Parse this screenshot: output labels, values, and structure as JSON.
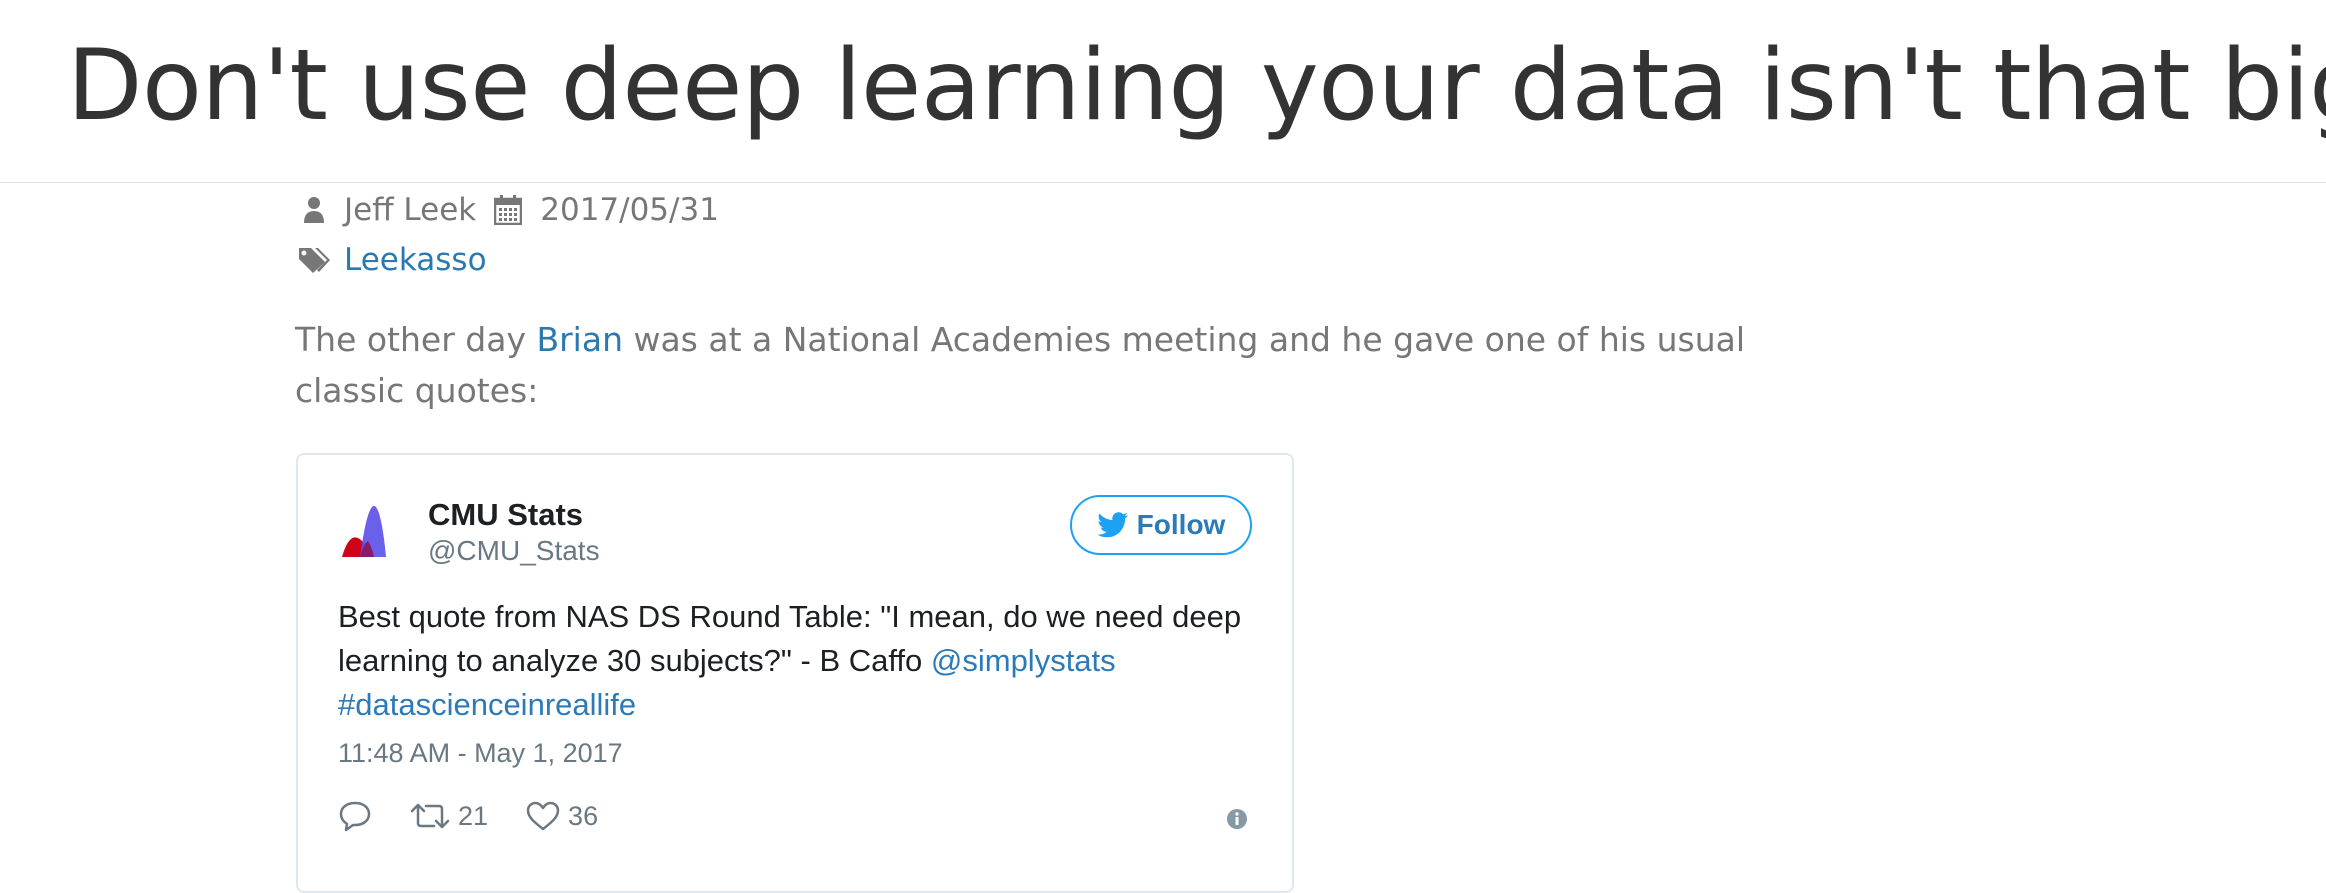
{
  "post": {
    "title": "Don't use deep learning your data isn't that big",
    "author": "Jeff Leek",
    "date": "2017/05/31",
    "tag": "Leekasso"
  },
  "intro": {
    "before_link": "The other day ",
    "link_text": "Brian",
    "after_link": " was at a National Academies meeting and he gave one of his usual classic quotes:"
  },
  "tweet": {
    "user_name": "CMU Stats",
    "user_handle": "@CMU_Stats",
    "follow_label": "Follow",
    "text_main": "Best quote from NAS DS Round Table: \"I mean, do we need deep learning to analyze 30 subjects?\" - B Caffo ",
    "mention": "@simplystats",
    "hashtag": "#datascienceinreallife",
    "timestamp": "11:48 AM - May 1, 2017",
    "retweet_count": "21",
    "like_count": "36"
  },
  "icons": {
    "author": "user-icon",
    "date": "calendar-icon",
    "tags": "tags-icon",
    "reply": "reply-icon",
    "retweet": "retweet-icon",
    "like": "heart-icon",
    "info": "info-icon",
    "follow": "twitter-bird-icon"
  },
  "colors": {
    "link": "#2a7ab0",
    "meta_text": "#777777",
    "title_text": "#333333",
    "twitter_blue": "#1da1f2"
  }
}
